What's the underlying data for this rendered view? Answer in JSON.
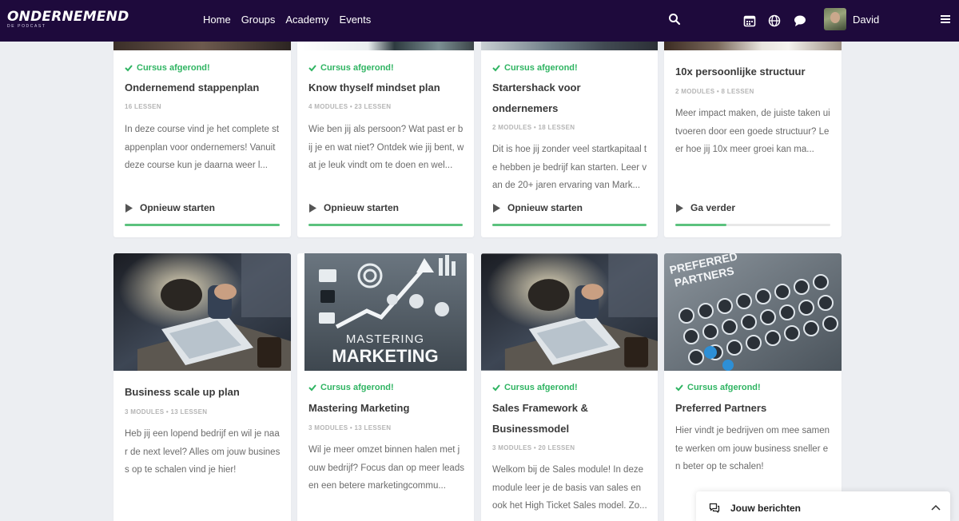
{
  "header": {
    "logo_text": "ONDERNEMEND",
    "logo_subtext": "DE PODCAST",
    "nav": [
      "Home",
      "Groups",
      "Academy",
      "Events"
    ],
    "user_name": "David",
    "icons": [
      "search-icon",
      "calendar-icon",
      "globe-icon",
      "chat-icon",
      "menu-icon"
    ]
  },
  "courses_row1": [
    {
      "badge": "Cursus afgerond!",
      "title": "Ondernemend stappenplan",
      "meta": "16 LESSEN",
      "description": "In deze course vind je het complete stappenplan voor ondernemers! Vanuit deze course kun je daarna weer l...",
      "action": "Opnieuw starten",
      "progress": 1.0
    },
    {
      "badge": "Cursus afgerond!",
      "title": "Know thyself mindset plan",
      "meta": "4 MODULES  •  23 LESSEN",
      "description": "Wie ben jij als persoon? Wat past er bij je en wat niet? Ontdek wie jij bent, wat je leuk vindt om te doen en wel...",
      "action": "Opnieuw starten",
      "progress": 1.0
    },
    {
      "badge": "Cursus afgerond!",
      "title": "Startershack voor ondernemers",
      "meta": "2 MODULES  •  18 LESSEN",
      "description": "Dit is hoe jij zonder veel startkapitaal te hebben je bedrijf kan starten. Leer van de 20+ jaren ervaring van Mark...",
      "action": "Opnieuw starten",
      "progress": 1.0
    },
    {
      "badge": "",
      "title": "10x persoonlijke structuur",
      "meta": "2 MODULES  •  8 LESSEN",
      "description": "Meer impact maken, de juiste taken uitvoeren door een goede structuur? Leer hoe jij 10x meer groei kan ma...",
      "action": "Ga verder",
      "progress": 0.33
    }
  ],
  "courses_row2": [
    {
      "badge": "",
      "title": "Business scale up plan",
      "meta": "3 MODULES  •  13 LESSEN",
      "description": "Heb jij een lopend bedrijf en wil je naar de next level? Alles om jouw business op te schalen vind je hier!",
      "image": "business-meeting-image"
    },
    {
      "badge": "Cursus afgerond!",
      "title": "Mastering Marketing",
      "meta": "3 MODULES  •  13 LESSEN",
      "description": "Wil je meer omzet binnen halen met jouw bedrijf? Focus dan op meer leads en een betere marketingcommu...",
      "image": "mastering-marketing-image",
      "image_text": [
        "MASTERING",
        "MARKETING"
      ]
    },
    {
      "badge": "Cursus afgerond!",
      "title": "Sales Framework & Businessmodel",
      "meta": "3 MODULES  •  20 LESSEN",
      "description": "Welkom bij de Sales module! In deze module leer je de basis van sales en ook het High Ticket Sales model. Zo...",
      "image": "business-meeting-image"
    },
    {
      "badge": "Cursus afgerond!",
      "title": "Preferred Partners",
      "meta": "",
      "description": "Hier vindt je bedrijven om mee samen te werken om jouw business sneller en beter op te schalen!",
      "image": "preferred-partners-image",
      "image_text": [
        "PREFERRED",
        "PARTNERS"
      ]
    }
  ],
  "messages": {
    "label": "Jouw berichten"
  },
  "colors": {
    "header_bg": "#1e0a3c",
    "accent_green": "#2fb462",
    "progress_green": "#5cc27e",
    "page_bg": "#eceef2"
  }
}
